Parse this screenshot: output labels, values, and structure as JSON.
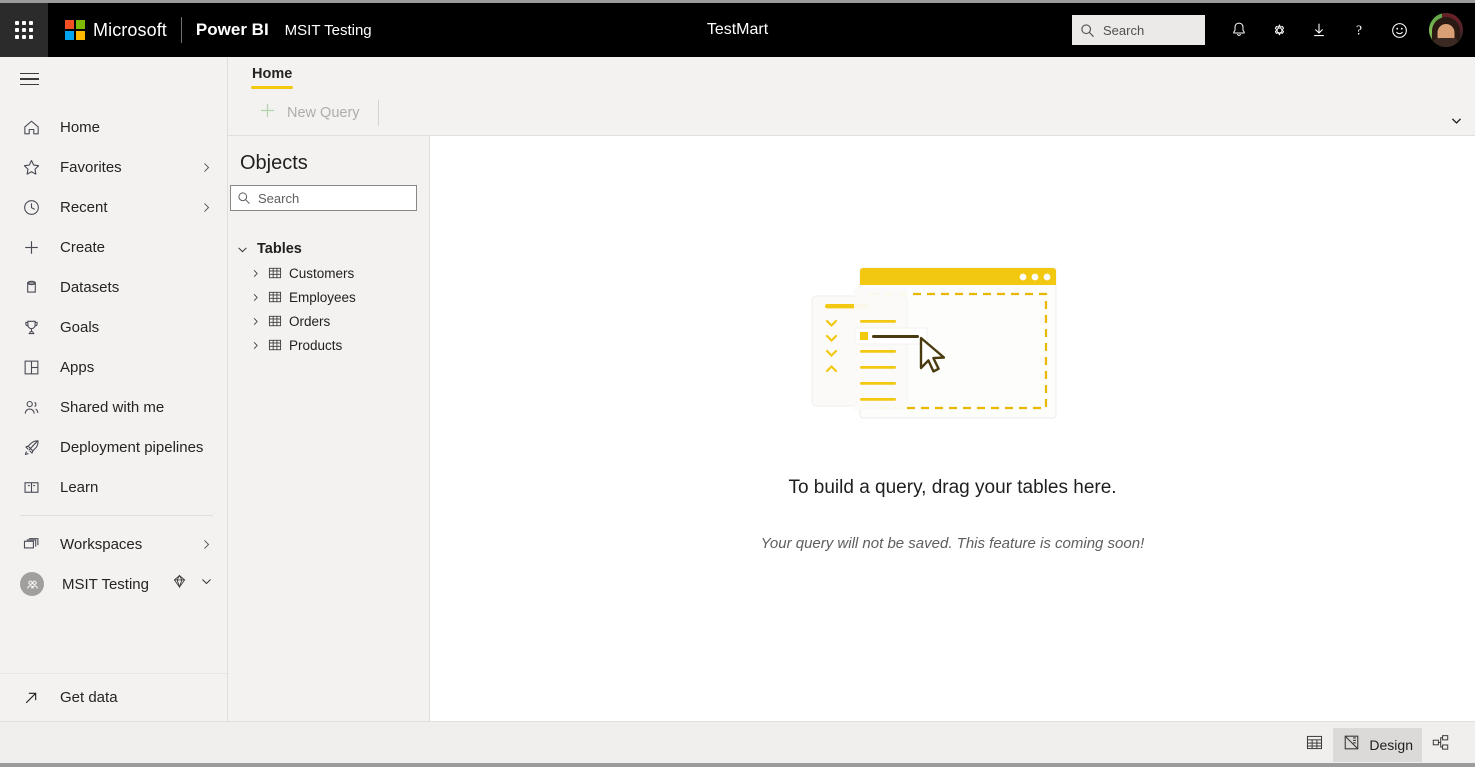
{
  "header": {
    "waffle_label": "app-launcher",
    "brand": "Microsoft",
    "product": "Power BI",
    "workspace": "MSIT Testing",
    "document_title": "TestMart",
    "search_placeholder": "Search",
    "icons": [
      {
        "name": "notifications-icon",
        "glyph": "bell"
      },
      {
        "name": "settings-icon",
        "glyph": "gear"
      },
      {
        "name": "download-icon",
        "glyph": "download"
      },
      {
        "name": "help-icon",
        "glyph": "question"
      },
      {
        "name": "feedback-icon",
        "glyph": "smiley"
      }
    ],
    "avatar_label": "user-avatar"
  },
  "sidebar": {
    "collapse_label": "navigation-menu",
    "items": [
      {
        "label": "Home",
        "icon": "home-icon",
        "chevron": false
      },
      {
        "label": "Favorites",
        "icon": "star-icon",
        "chevron": true
      },
      {
        "label": "Recent",
        "icon": "clock-icon",
        "chevron": true
      },
      {
        "label": "Create",
        "icon": "plus-icon",
        "chevron": false
      },
      {
        "label": "Datasets",
        "icon": "database-icon",
        "chevron": false
      },
      {
        "label": "Goals",
        "icon": "trophy-icon",
        "chevron": false
      },
      {
        "label": "Apps",
        "icon": "apps-icon",
        "chevron": false
      },
      {
        "label": "Shared with me",
        "icon": "people-icon",
        "chevron": false
      },
      {
        "label": "Deployment pipelines",
        "icon": "rocket-icon",
        "chevron": false
      },
      {
        "label": "Learn",
        "icon": "book-icon",
        "chevron": false
      }
    ],
    "workspaces": {
      "label": "Workspaces",
      "icon": "workspaces-icon",
      "chevron": true
    },
    "current_workspace": {
      "label": "MSIT Testing",
      "icon": "workspace-avatar",
      "badge": "premium-diamond-icon"
    },
    "get_data": {
      "label": "Get data",
      "icon": "arrow-up-right-icon"
    }
  },
  "ribbon": {
    "tabs": [
      {
        "label": "Home",
        "active": true
      }
    ],
    "commands": [
      {
        "label": "New Query",
        "icon": "plus-icon",
        "disabled": true
      }
    ],
    "expand_label": "expand-ribbon"
  },
  "objects_panel": {
    "title": "Objects",
    "search_placeholder": "Search",
    "group": {
      "label": "Tables",
      "expanded": true
    },
    "tables": [
      {
        "label": "Customers"
      },
      {
        "label": "Employees"
      },
      {
        "label": "Orders"
      },
      {
        "label": "Products"
      }
    ]
  },
  "canvas": {
    "heading": "To build a query, drag your tables here.",
    "subtext": "Your query will not be saved. This feature is coming soon!",
    "illustration_label": "drag-tables-illustration"
  },
  "status_bar": {
    "buttons": [
      {
        "label": "",
        "icon": "table-grid-icon",
        "active": false
      },
      {
        "label": "Design",
        "icon": "design-ruler-icon",
        "active": true
      },
      {
        "label": "",
        "icon": "model-diagram-icon",
        "active": false
      }
    ]
  },
  "colors": {
    "accent_yellow": "#f2c811",
    "header_black": "#000000",
    "panel_gray": "#f3f2f1",
    "canvas_white": "#ffffff",
    "text_primary": "#201f1e",
    "text_muted": "#605e5c",
    "disabled_gray": "#8a8886"
  }
}
